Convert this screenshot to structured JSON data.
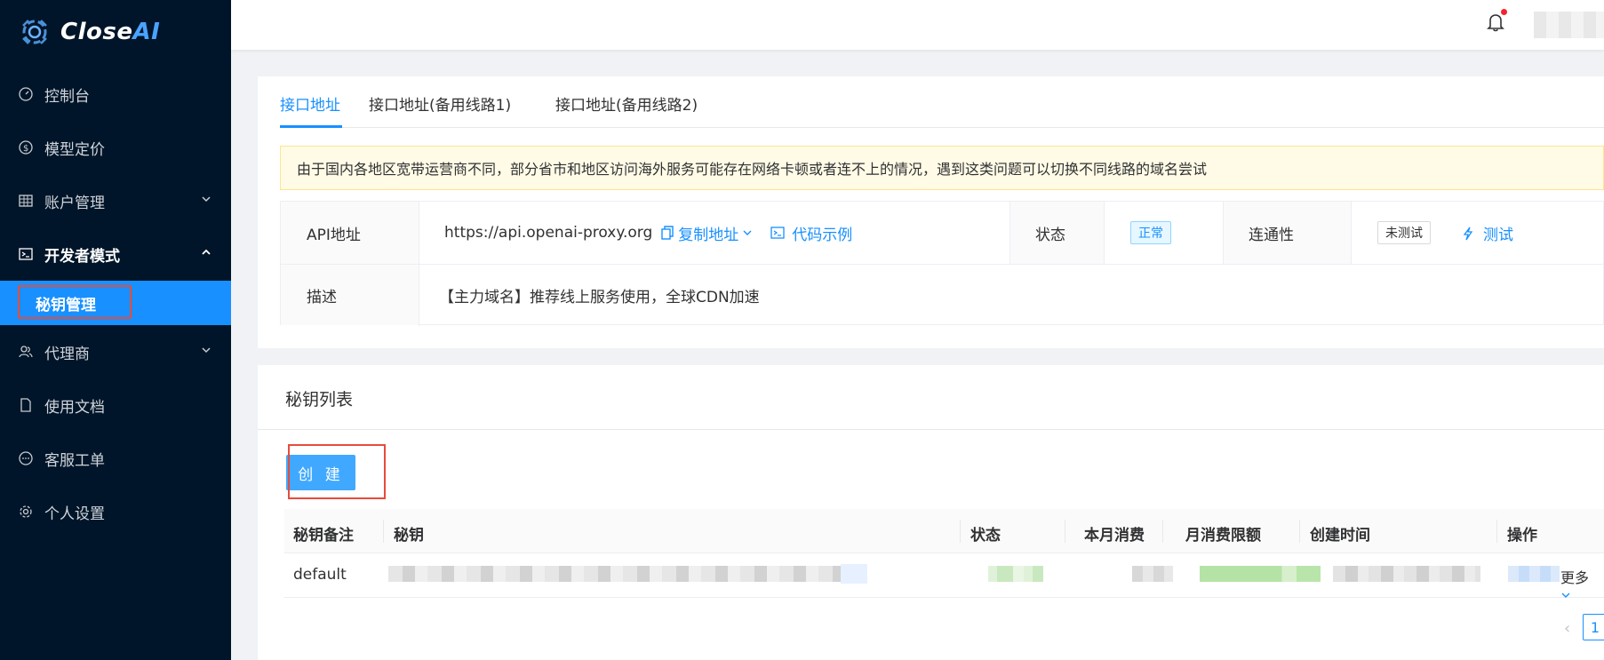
{
  "app": {
    "brand_part1": "Close",
    "brand_part2": "AI"
  },
  "sidebar": {
    "items": [
      {
        "label": "控制台",
        "icon": "dashboard-icon"
      },
      {
        "label": "模型定价",
        "icon": "dollar-icon"
      },
      {
        "label": "账户管理",
        "icon": "table-icon"
      },
      {
        "label": "开发者模式",
        "icon": "code-icon"
      },
      {
        "label": "秘钥管理"
      },
      {
        "label": "代理商",
        "icon": "users-icon"
      },
      {
        "label": "使用文档",
        "icon": "file-icon"
      },
      {
        "label": "客服工单",
        "icon": "message-icon"
      },
      {
        "label": "个人设置",
        "icon": "gear-icon"
      }
    ]
  },
  "api_card": {
    "tabs": [
      "接口地址",
      "接口地址(备用线路1)",
      "接口地址(备用线路2)"
    ],
    "notice": "由于国内各地区宽带运营商不同，部分省市和地区访问海外服务可能存在网络卡顿或者连不上的情况，遇到这类问题可以切换不同线路的域名尝试",
    "api_label": "API地址",
    "api_url": "https://api.openai-proxy.org",
    "copy_label": "复制地址",
    "code_label": "代码示例",
    "status_label": "状态",
    "status_value": "正常",
    "conn_label": "连通性",
    "conn_value": "未测试",
    "test_label": "测试",
    "desc_label": "描述",
    "desc_value": "【主力域名】推荐线上服务使用，全球CDN加速"
  },
  "keys_card": {
    "title": "秘钥列表",
    "create_label": "创 建",
    "columns": [
      "秘钥备注",
      "秘钥",
      "状态",
      "本月消费",
      "月消费限额",
      "创建时间",
      "操作"
    ],
    "rows": [
      {
        "note": "default",
        "more": "更多"
      }
    ],
    "pagination": {
      "current": "1"
    }
  }
}
